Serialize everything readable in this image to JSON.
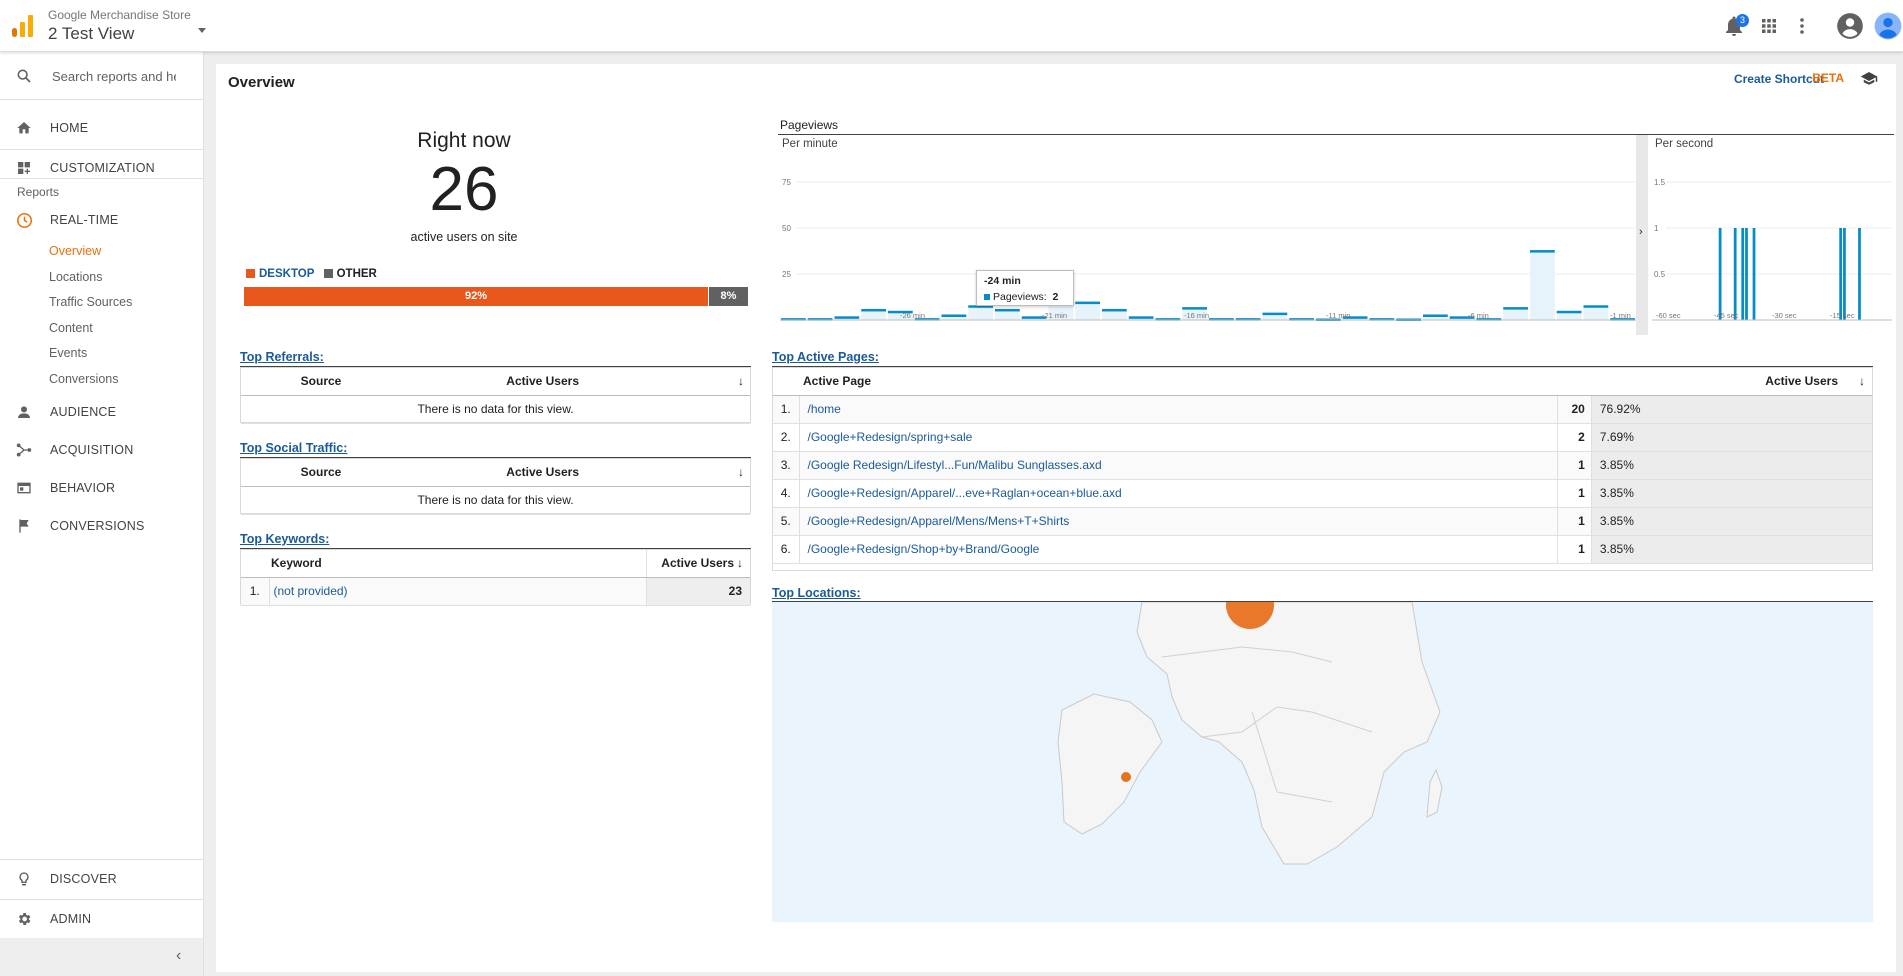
{
  "header": {
    "account_name": "Google Merchandise Store",
    "view_name": "2 Test View",
    "notifications_count": "3"
  },
  "sidebar": {
    "search_placeholder": "Search reports and help",
    "home": "HOME",
    "customization": "CUSTOMIZATION",
    "reports_label": "Reports",
    "realtime": "REAL-TIME",
    "realtime_items": [
      "Overview",
      "Locations",
      "Traffic Sources",
      "Content",
      "Events",
      "Conversions"
    ],
    "audience": "AUDIENCE",
    "acquisition": "ACQUISITION",
    "behavior": "BEHAVIOR",
    "conversions": "CONVERSIONS",
    "discover": "DISCOVER",
    "admin": "ADMIN",
    "collapse": "‹"
  },
  "main": {
    "title": "Overview",
    "create_shortcut": "Create Shortcut",
    "beta": "BETA",
    "right_now": {
      "title": "Right now",
      "count": "26",
      "subtitle": "active users on site"
    },
    "devices": {
      "desktop_label": "DESKTOP",
      "other_label": "OTHER",
      "desktop_pct": "92%",
      "other_pct": "8%",
      "desktop_fraction": 0.92,
      "desktop_color": "#e8581c",
      "other_color": "#616161"
    },
    "top_referrals": {
      "title": "Top Referrals:",
      "col_source": "Source",
      "col_users": "Active Users",
      "empty": "There is no data for this view."
    },
    "top_social": {
      "title": "Top Social Traffic:",
      "col_source": "Source",
      "col_users": "Active Users",
      "empty": "There is no data for this view."
    },
    "top_keywords": {
      "title": "Top Keywords:",
      "col_keyword": "Keyword",
      "col_users": "Active Users",
      "rows": [
        {
          "n": "1.",
          "keyword": "(not provided)",
          "users": "23"
        }
      ]
    },
    "top_pages": {
      "title": "Top Active Pages:",
      "col_page": "Active Page",
      "col_users": "Active Users",
      "rows": [
        {
          "n": "1.",
          "page": "/home",
          "users": "20",
          "pct": "76.92%"
        },
        {
          "n": "2.",
          "page": "/Google+Redesign/spring+sale",
          "users": "2",
          "pct": "7.69%"
        },
        {
          "n": "3.",
          "page": "/Google Redesign/Lifestyl...Fun/Malibu Sunglasses.axd",
          "users": "1",
          "pct": "3.85%"
        },
        {
          "n": "4.",
          "page": "/Google+Redesign/Apparel/...eve+Raglan+ocean+blue.axd",
          "users": "1",
          "pct": "3.85%"
        },
        {
          "n": "5.",
          "page": "/Google+Redesign/Apparel/Mens/Mens+T+Shirts",
          "users": "1",
          "pct": "3.85%"
        },
        {
          "n": "6.",
          "page": "/Google+Redesign/Shop+by+Brand/Google",
          "users": "1",
          "pct": "3.85%"
        }
      ]
    },
    "top_locations": {
      "title": "Top Locations:"
    },
    "pageviews": {
      "title": "Pageviews",
      "per_minute": "Per minute",
      "per_second": "Per second",
      "tooltip_time": "-24 min",
      "tooltip_label": "Pageviews:",
      "tooltip_value": "2"
    }
  },
  "chart_data": [
    {
      "type": "bar",
      "title": "Per minute",
      "ylim": [
        0,
        75
      ],
      "y_ticks": [
        "75",
        "50",
        "25"
      ],
      "x_ticks": [
        "-26 min",
        "-21 min",
        "-16 min",
        "-11 min",
        "-6 min",
        "-1 min"
      ],
      "values": [
        1,
        1,
        2,
        6,
        5,
        1,
        3,
        8,
        6,
        2,
        9,
        10,
        6,
        2,
        1,
        7,
        1,
        1,
        4,
        1,
        0,
        2,
        1,
        0,
        3,
        2,
        1,
        7,
        38,
        5,
        8,
        1
      ],
      "color": "#058dc7"
    },
    {
      "type": "bar",
      "title": "Per second",
      "ylim": [
        0,
        1.5
      ],
      "y_ticks": [
        "1.5",
        "1",
        "0.5"
      ],
      "x_ticks": [
        "-60 sec",
        "-45 sec",
        "-30 sec",
        "-15 sec"
      ],
      "values": [
        0,
        0,
        0,
        0,
        0,
        0,
        0,
        0,
        0,
        0,
        0,
        0,
        0,
        0,
        1,
        0,
        0,
        0,
        1,
        0,
        1,
        1,
        0,
        1,
        0,
        0,
        0,
        0,
        0,
        0,
        0,
        0,
        0,
        0,
        0,
        0,
        0,
        0,
        0,
        0,
        0,
        0,
        0,
        0,
        0,
        0,
        1,
        1,
        0,
        0,
        0,
        1,
        0,
        0,
        0,
        0,
        0,
        0,
        0,
        0
      ],
      "color": "#058dc7"
    }
  ]
}
